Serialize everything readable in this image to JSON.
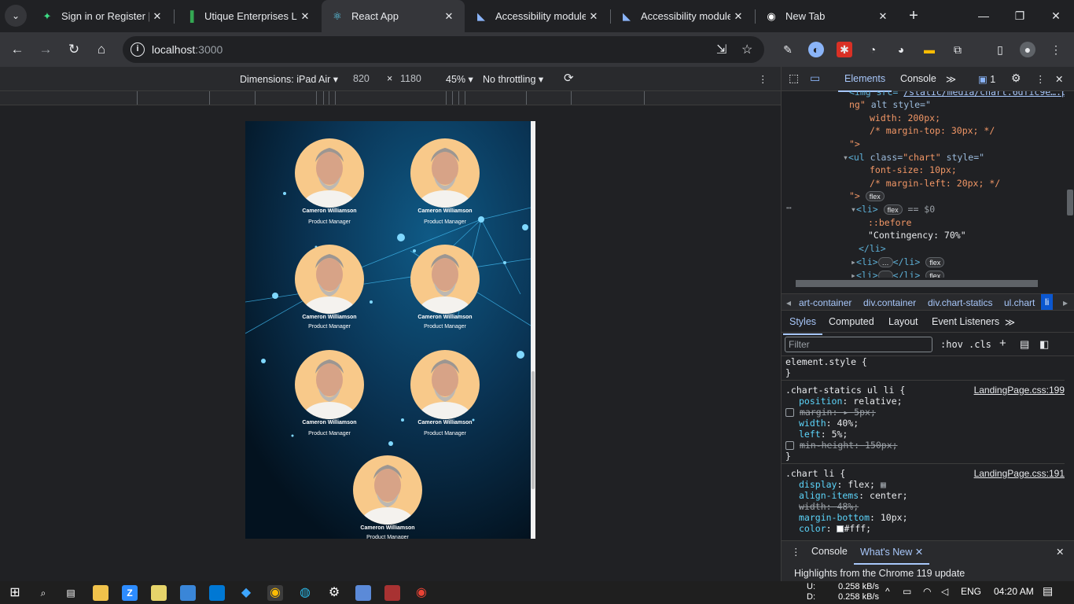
{
  "tabs": [
    {
      "title": "Sign in or Register | A",
      "icon": "runner-icon"
    },
    {
      "title": "Utique Enterprises Ltd",
      "icon": "bar-chart-icon"
    },
    {
      "title": "React App",
      "icon": "react-icon"
    },
    {
      "title": "Accessibility module",
      "icon": "module-icon"
    },
    {
      "title": "Accessibility module",
      "icon": "module-icon"
    },
    {
      "title": "New Tab",
      "icon": "chrome-icon"
    }
  ],
  "address": {
    "host": "localhost",
    "port": ":3000"
  },
  "device_toolbar": {
    "dimensions": "Dimensions: iPad Air",
    "width": "820",
    "x": "×",
    "height": "1180",
    "zoom": "45%",
    "throttling": "No throttling"
  },
  "page": {
    "cards": [
      {
        "name": "Cameron Williamson",
        "role": "Product Manager"
      },
      {
        "name": "Cameron Williamson",
        "role": "Product Manager"
      },
      {
        "name": "Cameron Williamson",
        "role": "Product Manager"
      },
      {
        "name": "Cameron Williamson",
        "role": "Product Manager"
      },
      {
        "name": "Cameron Williamson",
        "role": "Product Manager"
      },
      {
        "name": "Cameron Williamson",
        "role": "Product Manager"
      },
      {
        "name": "Cameron Williamson",
        "role": "Product Manager"
      }
    ]
  },
  "devtools": {
    "tabs": [
      "Elements",
      "Console"
    ],
    "issues_count": "1",
    "code": {
      "l1a": "<img src=\"",
      "l1b": "/static/media/chart.6dfic9e….p",
      "l2a": "ng\"",
      "l2b": " alt style=\"",
      "l3": "width: 200px;",
      "l4": "/* margin-top: 30px; */",
      "l5": "\">",
      "l6a": "<ul",
      "l6b": " class=",
      "l6c": "\"chart\"",
      "l6d": " style=\"",
      "l7": "font-size: 10px;",
      "l8": "/* margin-left: 20px; */",
      "l9": "\">",
      "pill_flex": "flex",
      "l10": "<li>",
      "l10b": "== $0",
      "l11": "::before",
      "l12": "\"Contingency: 70%\"",
      "l13": "</li>",
      "l14": "<li>",
      "l14b": "</li>",
      "dots": "…"
    },
    "breadcrumbs": [
      "art-container",
      "div.container",
      "div.chart-statics",
      "ul.chart",
      "li"
    ],
    "style_tabs": [
      "Styles",
      "Computed",
      "Layout",
      "Event Listeners"
    ],
    "filter_placeholder": "Filter",
    "hov": ":hov",
    "cls": ".cls",
    "rules": {
      "element_style": "element.style {",
      "close": "}",
      "r1_selector": ".chart-statics ul li {",
      "r1_src": "LandingPage.css:199",
      "r1_p1": "position",
      "r1_v1": "relative;",
      "r1_p2": "margin: ▸ 5px;",
      "r1_p3": "width",
      "r1_v3": "40%;",
      "r1_p4": "left",
      "r1_v4": "5%;",
      "r1_p5": "min-height: 150px;",
      "r2_selector": ".chart li {",
      "r2_src": "LandingPage.css:191",
      "r2_p1": "display",
      "r2_v1": "flex;",
      "r2_p2": "align-items",
      "r2_v2": "center;",
      "r2_p3": "width: 48%;",
      "r2_p4": "margin-bottom",
      "r2_v4": "10px;",
      "r2_p5": "color",
      "r2_v5": "#fff;"
    },
    "drawer": {
      "console": "Console",
      "whats_new": "What's New",
      "highlight": "Highlights from the Chrome 119 update"
    }
  },
  "tray": {
    "up": "U:",
    "down": "D:",
    "up_rate": "0.258 kB/s",
    "down_rate": "0.258 kB/s",
    "lang": "ENG",
    "time": "04:20 AM"
  }
}
